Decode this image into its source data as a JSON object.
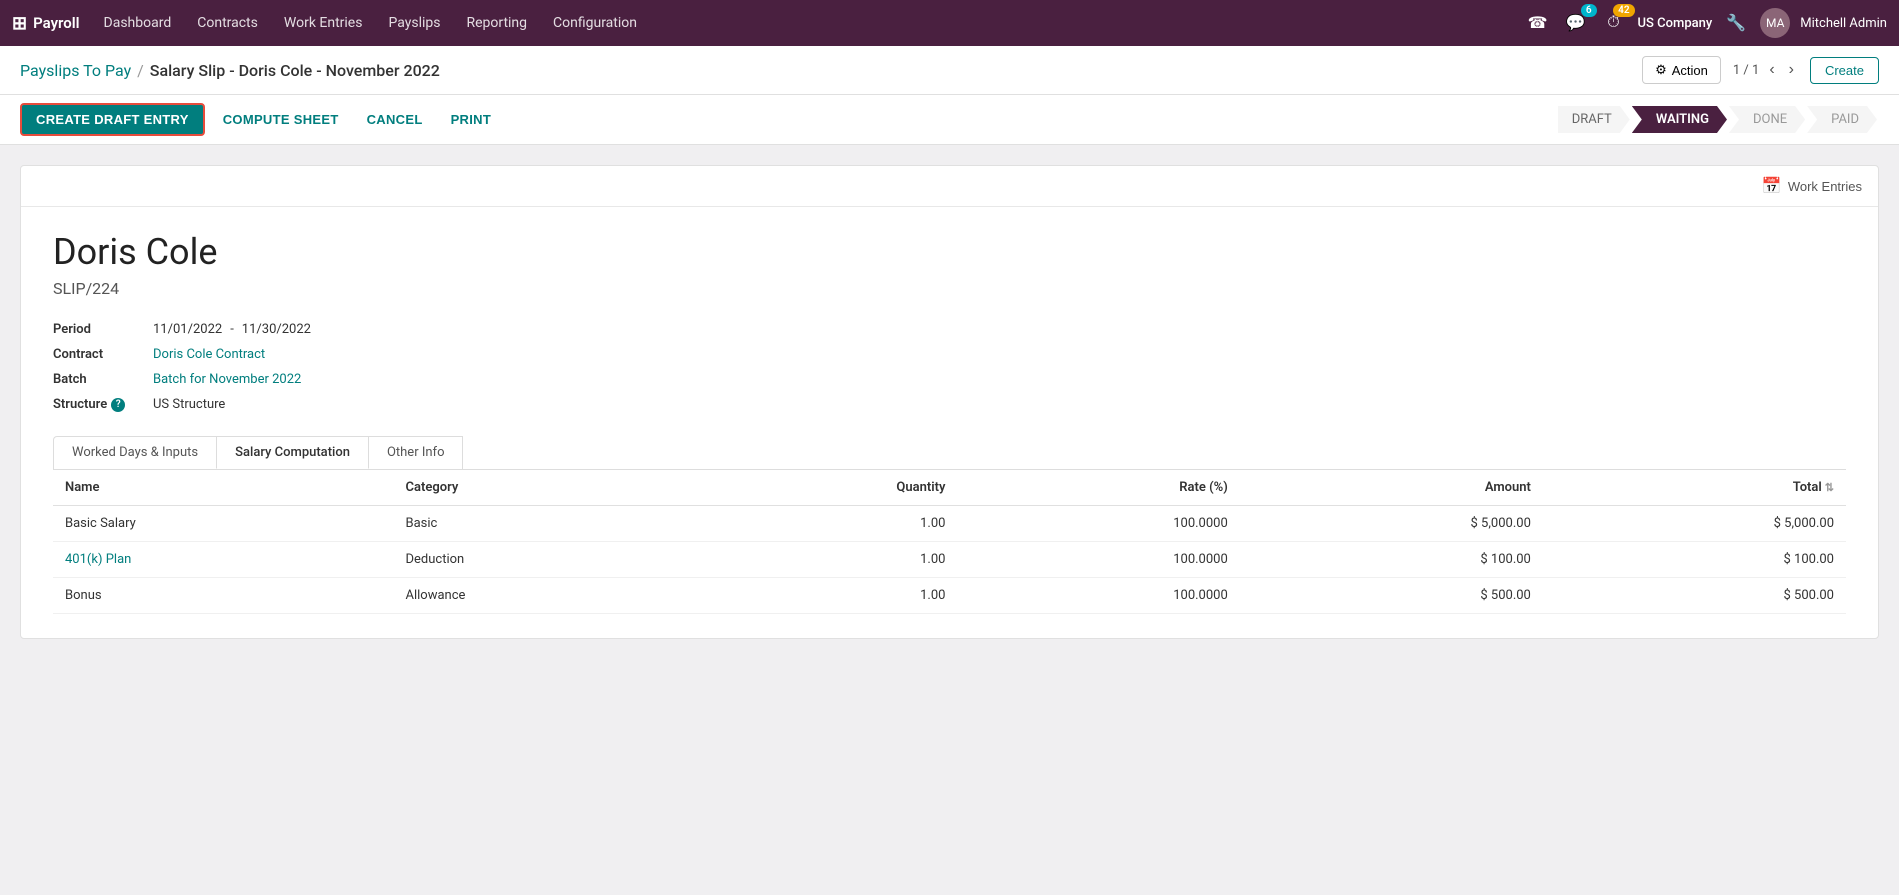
{
  "app": {
    "name": "Payroll",
    "grid_icon": "⊞"
  },
  "nav": {
    "links": [
      "Dashboard",
      "Contracts",
      "Work Entries",
      "Payslips",
      "Reporting",
      "Configuration"
    ]
  },
  "header_right": {
    "chat_badge": "6",
    "clock_badge": "42",
    "company": "US Company",
    "user": "Mitchell Admin"
  },
  "breadcrumb": {
    "parent": "Payslips To Pay",
    "separator": "/",
    "current": "Salary Slip - Doris Cole - November 2022"
  },
  "subheader": {
    "action_label": "Action",
    "pagination": "1 / 1",
    "create_label": "Create"
  },
  "toolbar": {
    "create_draft_label": "CREATE DRAFT ENTRY",
    "compute_sheet_label": "COMPUTE SHEET",
    "cancel_label": "CANCEL",
    "print_label": "PRINT"
  },
  "status": {
    "steps": [
      "DRAFT",
      "WAITING",
      "DONE",
      "PAID"
    ],
    "active": "WAITING"
  },
  "work_entries_btn": "Work Entries",
  "form": {
    "employee_name": "Doris Cole",
    "slip_number": "SLIP/224",
    "fields": [
      {
        "label": "Period",
        "value": "11/01/2022",
        "value2": "11/30/2022",
        "type": "date-range"
      },
      {
        "label": "Contract",
        "value": "Doris Cole Contract",
        "type": "link"
      },
      {
        "label": "Batch",
        "value": "Batch for November 2022",
        "type": "text"
      },
      {
        "label": "Structure",
        "value": "US Structure",
        "type": "text",
        "has_help": true
      }
    ],
    "tabs": [
      "Worked Days & Inputs",
      "Salary Computation",
      "Other Info"
    ],
    "active_tab": "Salary Computation",
    "table": {
      "headers": [
        "Name",
        "Category",
        "Quantity",
        "Rate (%)",
        "Amount",
        "Total"
      ],
      "rows": [
        {
          "name": "Basic Salary",
          "name_type": "text",
          "category": "Basic",
          "quantity": "1.00",
          "rate": "100.0000",
          "amount": "$ 5,000.00",
          "total": "$ 5,000.00"
        },
        {
          "name": "401(k) Plan",
          "name_type": "link",
          "category": "Deduction",
          "quantity": "1.00",
          "rate": "100.0000",
          "amount": "$ 100.00",
          "total": "$ 100.00"
        },
        {
          "name": "Bonus",
          "name_type": "text",
          "category": "Allowance",
          "quantity": "1.00",
          "rate": "100.0000",
          "amount": "$ 500.00",
          "total": "$ 500.00"
        }
      ]
    }
  }
}
